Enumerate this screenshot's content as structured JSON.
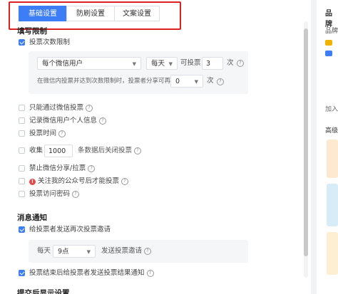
{
  "tabs": [
    {
      "label": "基础设置",
      "active": true
    },
    {
      "label": "防刷设置",
      "active": false
    },
    {
      "label": "文案设置",
      "active": false
    }
  ],
  "sections": {
    "fill_limit": "填写限制",
    "notify": "消息通知",
    "submit_display": "提交后显示设置"
  },
  "vote_limit": {
    "label": "投票次数限制",
    "checked": true,
    "user_select": "每个微信用户",
    "period_select": "每天",
    "vote_text": "可投票",
    "vote_count": "3",
    "unit": "次",
    "share_text": "在微信内投票并达到次数限制时，投票者分享可再投",
    "share_count": "0",
    "share_unit": "次"
  },
  "options": [
    {
      "key": "wechat_only",
      "label": "只能通过微信投票",
      "checked": false,
      "help": true
    },
    {
      "key": "record_info",
      "label": "记录微信用户个人信息",
      "checked": false,
      "help": true
    },
    {
      "key": "vote_time",
      "label": "投票时间",
      "checked": false,
      "help": true
    },
    {
      "key": "collect",
      "label": "收集",
      "checked": false,
      "help": true,
      "value": "1000",
      "suffix": "条数据后关闭投票"
    },
    {
      "key": "no_share",
      "label": "禁止微信分享/拉票",
      "checked": false,
      "help": true
    },
    {
      "key": "follow_account",
      "label": "关注我的公众号后才能投票",
      "checked": false,
      "help": true,
      "warning": true
    },
    {
      "key": "password",
      "label": "投票访问密码",
      "checked": false,
      "help": true
    }
  ],
  "notify": {
    "remind": {
      "label": "给投票者发送再次投票邀请",
      "checked": true
    },
    "period": "每天",
    "time": "9点",
    "send_text": "发送投票邀请",
    "result": {
      "label": "投票结束后给投票者发送投票结果通知",
      "checked": true
    }
  },
  "sidebar": {
    "title": "品牌",
    "label1": "品牌",
    "label2": "加入",
    "label3": "高级"
  },
  "colors": {
    "primary": "#3d7df6",
    "highlight": "#e02020",
    "warning": "#e84848"
  }
}
